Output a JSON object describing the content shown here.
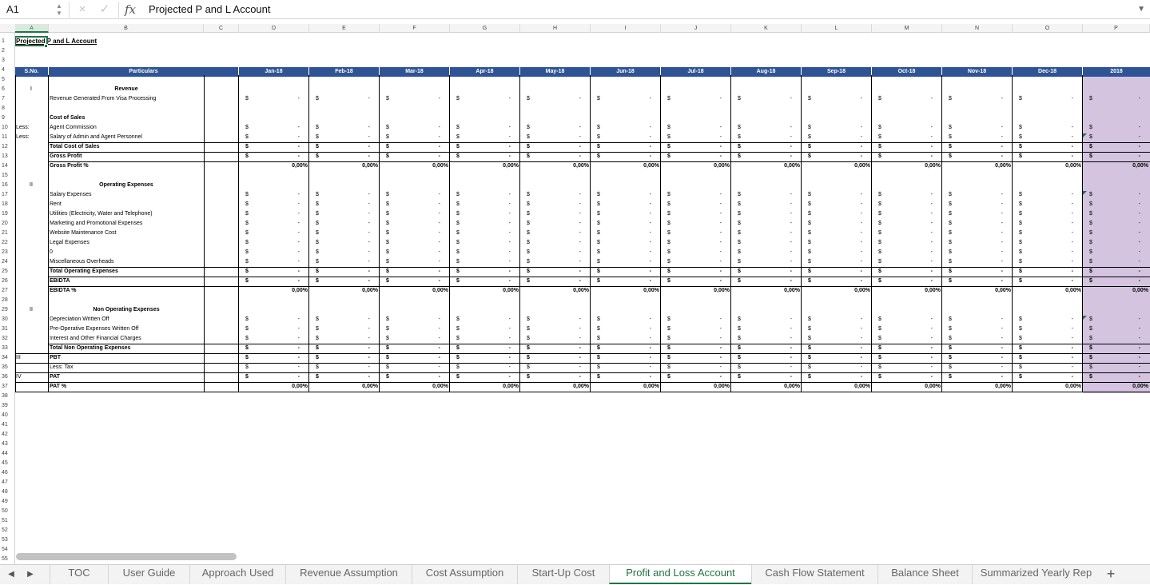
{
  "formula_bar": {
    "cell_ref": "A1",
    "cancel_icon": "×",
    "enter_icon": "✓",
    "fx_label": "fx",
    "content": "Projected P and L Account"
  },
  "columns": [
    "A",
    "B",
    "C",
    "D",
    "E",
    "F",
    "G",
    "H",
    "I",
    "J",
    "K",
    "L",
    "M",
    "N",
    "O",
    "P"
  ],
  "row_numbers": [
    "1",
    "2",
    "3",
    "4",
    "5",
    "6",
    "7",
    "8",
    "9",
    "10",
    "11",
    "12",
    "13",
    "14",
    "15",
    "16",
    "17",
    "18",
    "19",
    "20",
    "21",
    "22",
    "23",
    "24",
    "25",
    "26",
    "27",
    "28",
    "29",
    "30",
    "31",
    "32",
    "33",
    "34",
    "35",
    "36",
    "37",
    "38",
    "39",
    "40",
    "41",
    "42",
    "43",
    "44",
    "45",
    "46",
    "47",
    "48",
    "49",
    "50",
    "51",
    "52",
    "53",
    "54",
    "55"
  ],
  "sheet": {
    "title": "Projected P and L Account",
    "header": {
      "sno": "S.No.",
      "particulars": "Particulars",
      "months": [
        "Jan-18",
        "Feb-18",
        "Mar-18",
        "Apr-18",
        "May-18",
        "Jun-18",
        "Jul-18",
        "Aug-18",
        "Sep-18",
        "Oct-18",
        "Nov-18",
        "Dec-18"
      ],
      "year": "2018"
    },
    "rows": [
      {
        "row": 6,
        "sno": "I",
        "label": "Revenue",
        "bold": true,
        "center": true,
        "type": "blank"
      },
      {
        "row": 7,
        "label": "Revenue Generated From Visa Processing",
        "type": "currency"
      },
      {
        "row": 9,
        "label": "Cost of Sales",
        "bold": true,
        "type": "blank"
      },
      {
        "row": 10,
        "sno": "Less:",
        "label": "Agent Commission",
        "type": "currency"
      },
      {
        "row": 11,
        "sno": "Less:",
        "label": "Salary of Admin and Agent Personnel",
        "type": "currency"
      },
      {
        "row": 12,
        "label": "Total Cost of Sales",
        "bold": true,
        "type": "currency"
      },
      {
        "row": 13,
        "label": "Gross Profit",
        "bold": true,
        "type": "currency"
      },
      {
        "row": 14,
        "label": "Gross Profit %",
        "bold": true,
        "type": "percent"
      },
      {
        "row": 16,
        "sno": "II",
        "label": "Operating Expenses",
        "bold": true,
        "center": true,
        "type": "blank"
      },
      {
        "row": 17,
        "label": "Salary Expenses",
        "type": "currency"
      },
      {
        "row": 18,
        "label": "Rent",
        "type": "currency"
      },
      {
        "row": 19,
        "label": "Utilities (Electricity, Water and Telephone)",
        "type": "currency"
      },
      {
        "row": 20,
        "label": "Marketing and Promotional Expenses",
        "type": "currency"
      },
      {
        "row": 21,
        "label": "Website Maintenance Cost",
        "type": "currency"
      },
      {
        "row": 22,
        "label": "Legal Expenses",
        "type": "currency"
      },
      {
        "row": 23,
        "label": "0",
        "type": "currency"
      },
      {
        "row": 24,
        "label": "Miscellaneous Overheads",
        "type": "currency"
      },
      {
        "row": 25,
        "label": "Total Operating Expenses",
        "bold": true,
        "type": "currency"
      },
      {
        "row": 26,
        "label": "EBIDTA",
        "bold": true,
        "type": "currency"
      },
      {
        "row": 27,
        "label": "EBIDTA %",
        "bold": true,
        "type": "percent"
      },
      {
        "row": 29,
        "sno": "II",
        "label": "Non Operating Expenses",
        "bold": true,
        "center": true,
        "type": "blank"
      },
      {
        "row": 30,
        "label": "Depreciation Written Off",
        "type": "currency"
      },
      {
        "row": 31,
        "label": "Pre-Operative Expenses Written Off",
        "type": "currency"
      },
      {
        "row": 32,
        "label": "Interest and Other Financial Charges",
        "type": "currency"
      },
      {
        "row": 33,
        "label": "Total Non Operating Expenses",
        "bold": true,
        "type": "currency"
      },
      {
        "row": 34,
        "sno": "III",
        "label": "PBT",
        "bold": true,
        "type": "currency"
      },
      {
        "row": 35,
        "label": "Less: Tax",
        "type": "currency"
      },
      {
        "row": 36,
        "sno": "IV",
        "label": "PAT",
        "bold": true,
        "type": "currency"
      },
      {
        "row": 37,
        "label": "PAT %",
        "bold": true,
        "type": "percent"
      }
    ],
    "currency_symbol": "$",
    "dash": "-",
    "percent_value": "0,00%"
  },
  "tabs": [
    "TOC",
    "User Guide",
    "Approach Used",
    "Revenue Assumption",
    "Cost Assumption",
    "Start-Up Cost",
    "Profit and Loss Account",
    "Cash Flow Statement",
    "Balance Sheet",
    "Summarized Yearly Rep"
  ],
  "active_tab": "Profit and Loss Account",
  "tab_nav": {
    "prev": "◀",
    "next": "▶",
    "add": "+"
  },
  "accent": "#217346",
  "header_fill": "#2f5496",
  "year_fill": "#d4c4e0"
}
